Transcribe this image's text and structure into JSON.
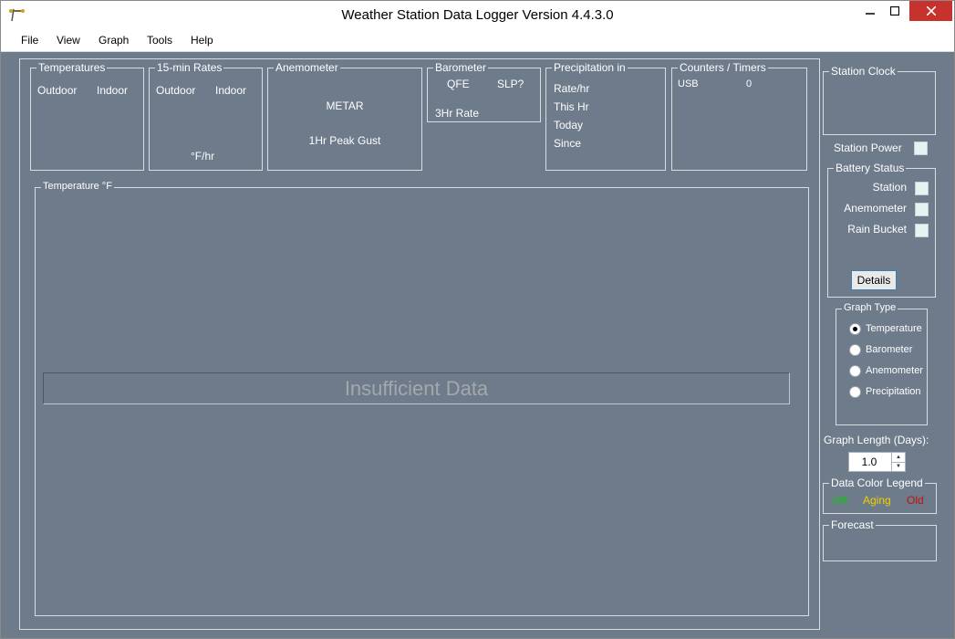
{
  "window": {
    "title": "Weather Station Data Logger Version 4.4.3.0"
  },
  "menu": {
    "items": [
      "File",
      "View",
      "Graph",
      "Tools",
      "Help"
    ]
  },
  "temperatures": {
    "title": "Temperatures",
    "outdoor": "Outdoor",
    "indoor": "Indoor"
  },
  "rates": {
    "title": "15-min Rates",
    "outdoor": "Outdoor",
    "indoor": "Indoor",
    "unit": "°F/hr"
  },
  "anemometer": {
    "title": "Anemometer",
    "metar": "METAR",
    "gust": "1Hr Peak Gust"
  },
  "barometer": {
    "title": "Barometer",
    "qfe": "QFE",
    "slp": "SLP?",
    "rate3hr": "3Hr Rate"
  },
  "precipitation": {
    "title": "Precipitation  in",
    "rate": "Rate/hr",
    "this_hr": "This Hr",
    "today": "Today",
    "since": "Since"
  },
  "counters": {
    "title": "Counters / Timers",
    "usb": "USB",
    "usb_value": "0"
  },
  "graph": {
    "title": "Temperature  °F",
    "message": "Insufficient Data"
  },
  "station_clock": {
    "title": "Station Clock"
  },
  "station_power": {
    "label": "Station Power"
  },
  "battery": {
    "title": "Battery Status",
    "station": "Station",
    "anemometer": "Anemometer",
    "rain_bucket": "Rain Bucket",
    "details": "Details"
  },
  "graph_type": {
    "title": "Graph Type",
    "options": [
      "Temperature",
      "Barometer",
      "Anemometer",
      "Precipitation"
    ],
    "selected": "Temperature"
  },
  "graph_length": {
    "label": "Graph Length (Days):",
    "value": "1.0"
  },
  "color_legend": {
    "title": "Data Color Legend",
    "ok": "OK",
    "aging": "Aging",
    "old": "Old",
    "ok_color": "#00d000",
    "aging_color": "#f0d000",
    "old_color": "#c01010"
  },
  "forecast": {
    "title": "Forecast"
  }
}
